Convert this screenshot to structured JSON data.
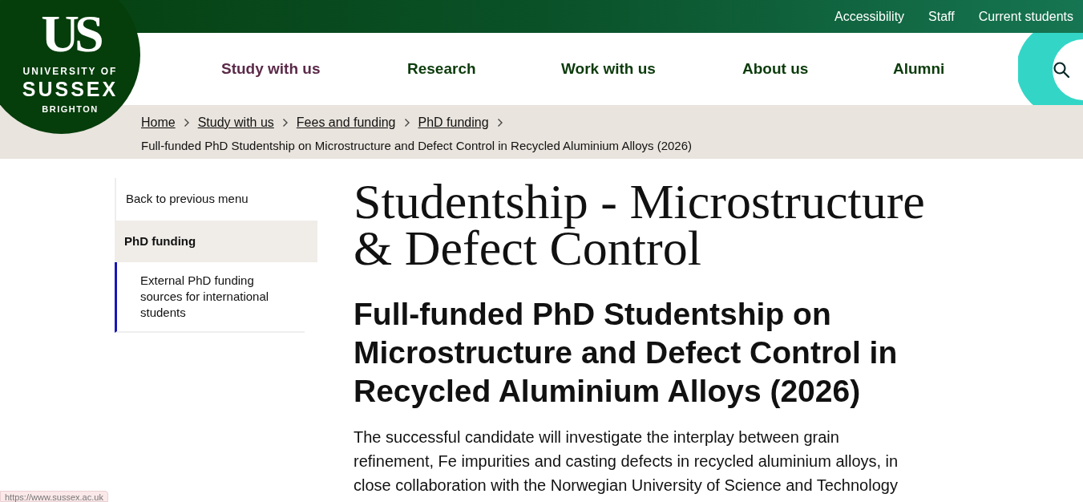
{
  "logo": {
    "monogram": "US",
    "line_1": "UNIVERSITY OF",
    "line_2": "SUSSEX",
    "line_3": "BRIGHTON"
  },
  "utility_links": [
    "Accessibility",
    "Staff",
    "Current students"
  ],
  "nav": [
    {
      "label": "Study with us",
      "selected": true
    },
    {
      "label": "Research",
      "selected": false
    },
    {
      "label": "Work with us",
      "selected": false
    },
    {
      "label": "About us",
      "selected": false
    },
    {
      "label": "Alumni",
      "selected": false
    }
  ],
  "breadcrumbs": {
    "links": [
      "Home",
      "Study with us",
      "Fees and funding",
      "PhD funding"
    ],
    "current": "Full-funded PhD Studentship on Microstructure and Defect Control in Recycled Aluminium Alloys (2026)"
  },
  "sidebar": {
    "back_link": "Back to previous menu",
    "section": "PhD funding",
    "items": [
      {
        "label": "External PhD funding sources for international students",
        "selected": true
      }
    ]
  },
  "page_title": "Studentship - Microstructure & Defect Control",
  "heading": "Full-funded PhD Studentship on Microstructure and Defect Control in Recycled Aluminium Alloys (2026)",
  "body": "The successful candidate will investigate the interplay between grain refinement, Fe impurities and casting defects in recycled aluminium alloys, in close collaboration with the Norwegian University of Science and Technology",
  "status_url": "https://www.sussex.ac.uk"
}
